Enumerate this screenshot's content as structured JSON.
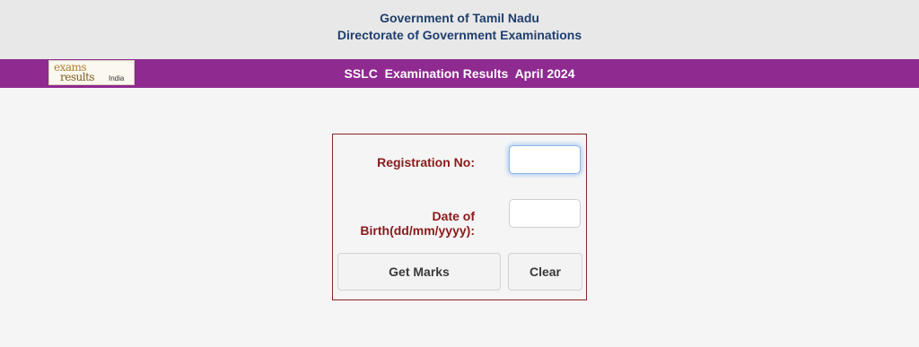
{
  "header": {
    "line1": "Government of Tamil Nadu",
    "line2": "Directorate of Government Examinations"
  },
  "banner": {
    "logo": {
      "line1": "exams",
      "line2": "results",
      "line3": "India"
    },
    "title": "SSLC  Examination Results  April 2024",
    "color": "#8e2a90"
  },
  "form": {
    "registration_label": "Registration No:",
    "registration_value": "",
    "dob_label": "Date of Birth(dd/mm/yyyy):",
    "dob_value": "",
    "get_marks_label": "Get Marks",
    "clear_label": "Clear",
    "label_color": "#8b1a1a",
    "border_color": "#8b2525"
  }
}
